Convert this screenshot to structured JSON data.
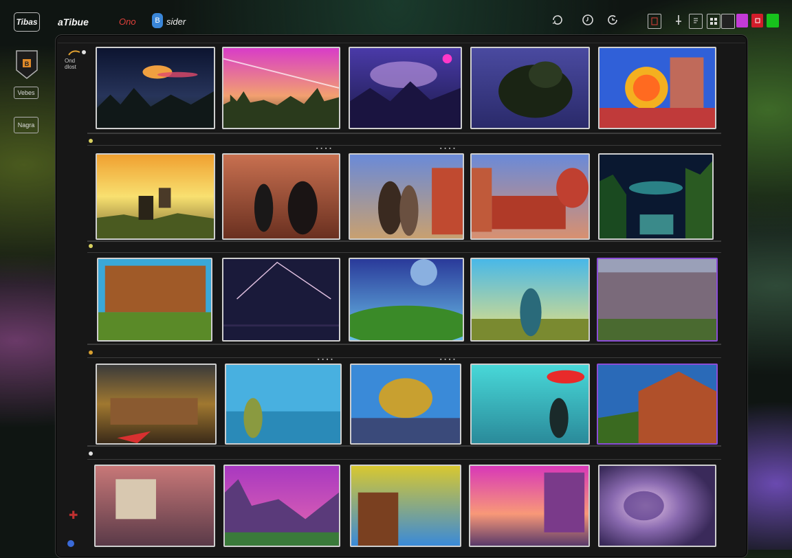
{
  "topbar": {
    "logo_text": "Tibas",
    "title": "aTibue",
    "red_label": "Ono",
    "mini_icon_glyph": "B",
    "status_label": "sider",
    "right_icons": [
      "refresh-icon",
      "clock-icon",
      "history-icon"
    ],
    "tools": [
      "layout-icon",
      "pin-icon",
      "page-icon",
      "grid-icon",
      "panel-icon"
    ],
    "swatches": [
      "#c23ad6",
      "#d21c2a",
      "#17c21c"
    ]
  },
  "rail": {
    "badge_glyph": "B",
    "item_1": "Vebes",
    "item_2": "Nagra"
  },
  "side_mini": {
    "line_1": "Ond",
    "line_2": "dlost"
  },
  "grid": {
    "rows": [
      {
        "dot_color": "#d8d060",
        "cells": [
          "space-ship-sunset",
          "pink-sky-city",
          "purple-mountain",
          "bush-night",
          "neon-palace"
        ]
      },
      {
        "dot_color": "#d8d060",
        "cells": [
          "golden-sunset",
          "sunset-silhouettes",
          "temple-figures",
          "red-palace",
          "starry-forest"
        ]
      },
      {
        "dot_color": "#d8a030",
        "cells": [
          "brick-mansion",
          "laser-night",
          "blue-planet",
          "grass-warrior",
          "ruined-arcade"
        ]
      },
      {
        "dot_color": "#e0e0e0",
        "cells": [
          "golden-ruins",
          "waterfall-city",
          "ornate-dome",
          "red-hat-wanderer",
          "fantasy-village"
        ]
      },
      {
        "dot_color": "#e0e0e0",
        "cells": [
          "retro-building",
          "purple-cliffs",
          "wooden-house",
          "sunrise-city",
          "blurred-sphere"
        ]
      }
    ]
  },
  "colors": {
    "accent_purple": "#8b4dd8",
    "panel": "#171717",
    "row_line": "#3c3c3c"
  }
}
